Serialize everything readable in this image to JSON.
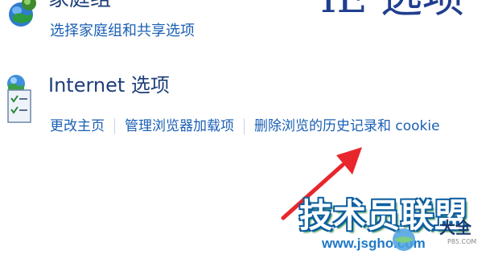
{
  "homegroup": {
    "title_partial": "家庭组",
    "link": "选择家庭组和共享选项",
    "right_title_partial": "IE 选项"
  },
  "internet_options": {
    "title": "Internet 选项",
    "links": [
      "更改主页",
      "管理浏览器加载项",
      "删除浏览的历史记录和 cookie"
    ]
  },
  "annotation": {
    "arrow_color": "#e8262c",
    "points_to": "删除浏览的历史记录和 cookie"
  },
  "watermark": {
    "logo_text": "技术员联盟",
    "daquan": "大全",
    "url": "www.jsgho.com",
    "small": "P85.COM"
  },
  "colors": {
    "link": "#1a5fb4",
    "title": "#1f3f7a",
    "arrow": "#e8262c"
  }
}
